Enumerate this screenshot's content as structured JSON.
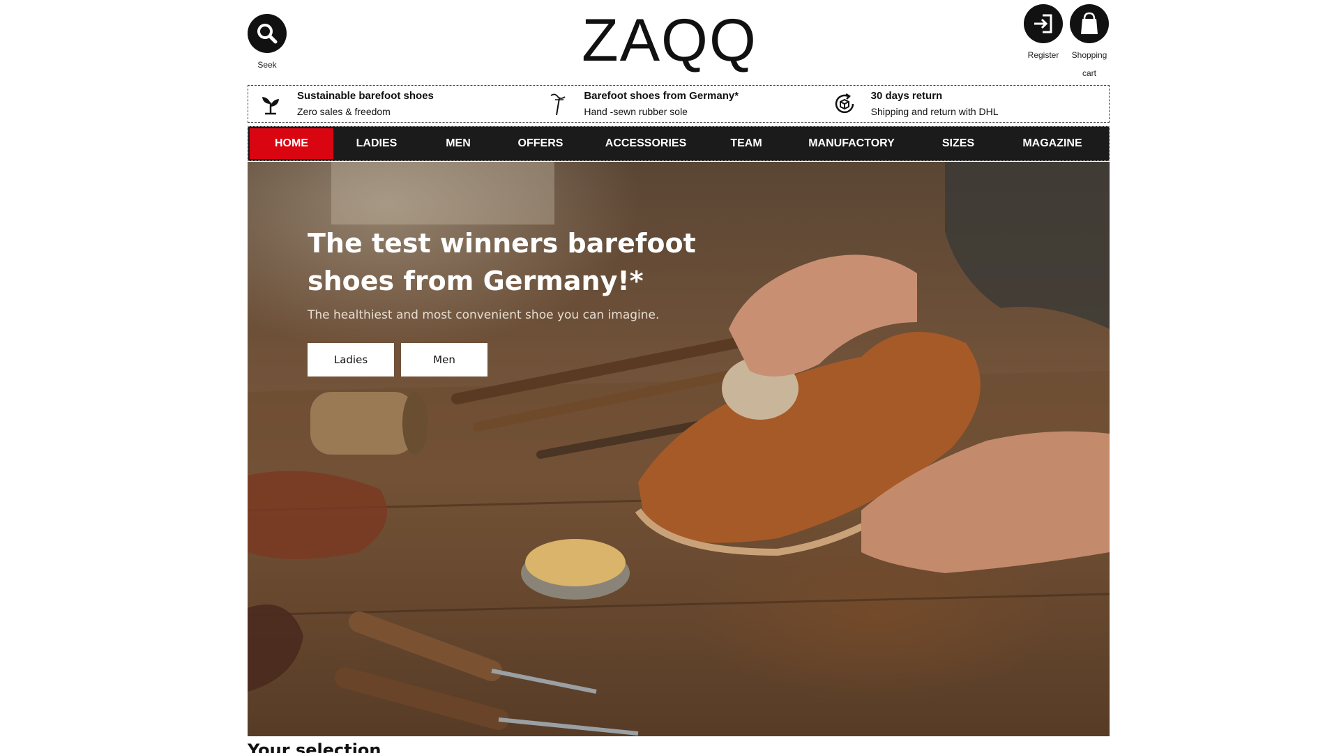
{
  "header": {
    "logo": "ZAQQ",
    "seek_label": "Seek",
    "register_label": "Register",
    "cart_label": "Shopping cart"
  },
  "usp": [
    {
      "icon": "leaf-icon",
      "title": "Sustainable barefoot shoes",
      "sub": "Zero sales & freedom"
    },
    {
      "icon": "needle-icon",
      "title": "Barefoot shoes from Germany*",
      "sub": "Hand -sewn rubber sole"
    },
    {
      "icon": "return-box-icon",
      "title": "30 days return",
      "sub": "Shipping and return with DHL"
    }
  ],
  "nav": {
    "items": [
      "HOME",
      "LADIES",
      "MEN",
      "OFFERS",
      "ACCESSORIES",
      "TEAM",
      "MANUFACTORY",
      "SIZES",
      "MAGAZINE"
    ],
    "active": "HOME"
  },
  "hero": {
    "title": "The test winners barefoot shoes from Germany!*",
    "subtitle": "The healthiest and most convenient shoe you can imagine.",
    "btn_ladies": "Ladies",
    "btn_men": "Men"
  },
  "section_title": "Your selection",
  "colors": {
    "accent": "#d90511",
    "nav_bg": "#1b1b1b"
  }
}
